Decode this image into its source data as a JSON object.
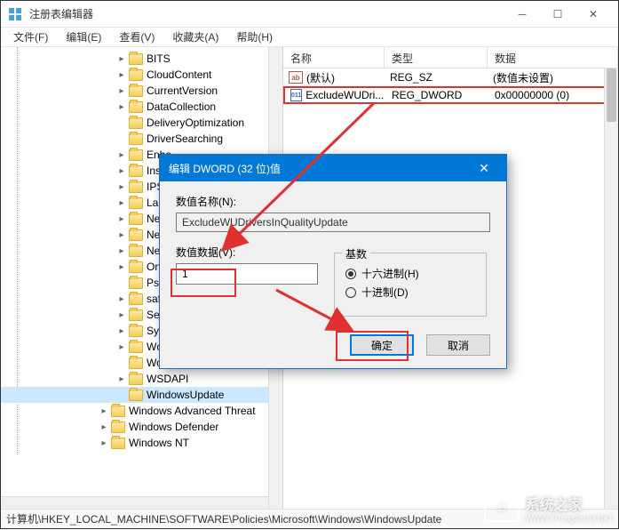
{
  "titlebar": {
    "title": "注册表编辑器"
  },
  "menu": {
    "file": "文件(F)",
    "edit": "编辑(E)",
    "view": "查看(V)",
    "favorites": "收藏夹(A)",
    "help": "帮助(H)"
  },
  "tree": {
    "items": [
      {
        "indent": 130,
        "toggle": "▸",
        "label": "BITS"
      },
      {
        "indent": 130,
        "toggle": "▸",
        "label": "CloudContent"
      },
      {
        "indent": 130,
        "toggle": "▸",
        "label": "CurrentVersion"
      },
      {
        "indent": 130,
        "toggle": "▸",
        "label": "DataCollection"
      },
      {
        "indent": 130,
        "toggle": "",
        "label": "DeliveryOptimization"
      },
      {
        "indent": 130,
        "toggle": "",
        "label": "DriverSearching"
      },
      {
        "indent": 130,
        "toggle": "▸",
        "label": "Enha"
      },
      {
        "indent": 130,
        "toggle": "▸",
        "label": "Insta"
      },
      {
        "indent": 130,
        "toggle": "▸",
        "label": "IPSec"
      },
      {
        "indent": 130,
        "toggle": "▸",
        "label": "Lanm"
      },
      {
        "indent": 130,
        "toggle": "▸",
        "label": "Netw"
      },
      {
        "indent": 130,
        "toggle": "▸",
        "label": "Netw"
      },
      {
        "indent": 130,
        "toggle": "▸",
        "label": "Netw"
      },
      {
        "indent": 130,
        "toggle": "▸",
        "label": "OneI"
      },
      {
        "indent": 130,
        "toggle": "",
        "label": "Psch"
      },
      {
        "indent": 130,
        "toggle": "▸",
        "label": "safer"
      },
      {
        "indent": 130,
        "toggle": "▸",
        "label": "Setti"
      },
      {
        "indent": 130,
        "toggle": "▸",
        "label": "Syste"
      },
      {
        "indent": 130,
        "toggle": "▸",
        "label": "Wcmsvc"
      },
      {
        "indent": 130,
        "toggle": "",
        "label": "WorkplaceJoin"
      },
      {
        "indent": 130,
        "toggle": "▸",
        "label": "WSDAPI"
      },
      {
        "indent": 130,
        "toggle": "",
        "label": "WindowsUpdate",
        "selected": true
      },
      {
        "indent": 110,
        "toggle": "▸",
        "label": "Windows Advanced Threat"
      },
      {
        "indent": 110,
        "toggle": "▸",
        "label": "Windows Defender"
      },
      {
        "indent": 110,
        "toggle": "▸",
        "label": "Windows NT"
      }
    ]
  },
  "list": {
    "cols": {
      "name": "名称",
      "type": "类型",
      "data": "数据"
    },
    "col_widths": {
      "name": 114,
      "type": 116,
      "data": 160
    },
    "rows": [
      {
        "icon": "ab",
        "name": "(默认)",
        "type": "REG_SZ",
        "data": "(数值未设置)",
        "hl": false
      },
      {
        "icon": "011",
        "name": "ExcludeWUDri...",
        "type": "REG_DWORD",
        "data": "0x00000000 (0)",
        "hl": true
      }
    ]
  },
  "dialog": {
    "title": "编辑 DWORD (32 位)值",
    "name_label": "数值名称(N):",
    "name_value": "ExcludeWUDriversInQualityUpdate",
    "data_label": "数值数据(V):",
    "data_value": "1",
    "base_label": "基数",
    "radio_hex": "十六进制(H)",
    "radio_dec": "十进制(D)",
    "ok": "确定",
    "cancel": "取消"
  },
  "statusbar": {
    "path": "计算机\\HKEY_LOCAL_MACHINE\\SOFTWARE\\Policies\\Microsoft\\Windows\\WindowsUpdate"
  },
  "watermark": {
    "text": "系统之家",
    "url": "WWW.XiTongZhiJia.NeT"
  }
}
